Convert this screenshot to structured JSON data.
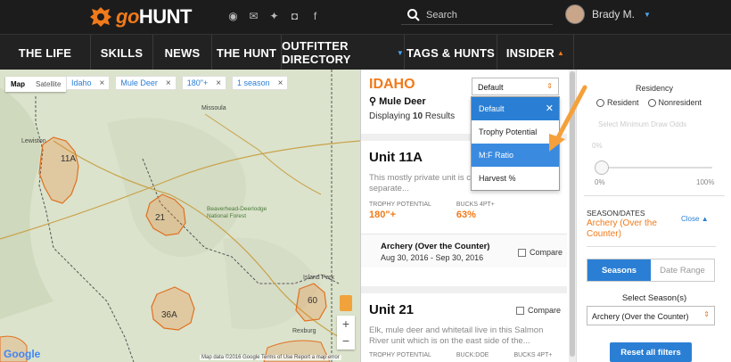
{
  "brand": {
    "logo_prefix": "go",
    "logo_name": "HUNT"
  },
  "header": {
    "search_placeholder": "Search",
    "user_name": "Brady M."
  },
  "nav": {
    "items": [
      "THE LIFE",
      "SKILLS",
      "NEWS",
      "THE HUNT",
      "OUTFITTER DIRECTORY",
      "TAGS & HUNTS",
      "INSIDER"
    ]
  },
  "map": {
    "type_map": "Map",
    "type_satellite": "Satellite",
    "chips": [
      "Idaho",
      "Mule Deer",
      "180\"+",
      "1 season"
    ],
    "units": [
      "11A",
      "21",
      "36A",
      "60"
    ],
    "cities": [
      "Missoula",
      "Lewiston",
      "Beaverhead-Deerlodge National Forest",
      "Island Park",
      "Rexburg"
    ],
    "footer": "Map data ©2016 Google   Terms of Use   Report a map error",
    "google": "Google"
  },
  "results": {
    "state": "IDAHO",
    "species": "Mule Deer",
    "displaying_prefix": "Displaying ",
    "count": "10",
    "displaying_suffix": " Results",
    "sort_selected": "Default",
    "sort_options": [
      "Default",
      "Trophy Potential",
      "M:F Ratio",
      "Harvest %"
    ],
    "cards": [
      {
        "unit": "Unit 11A",
        "desc": "This mostly private unit is c... fields and pastures separate...",
        "stat1_label": "TROPHY POTENTIAL",
        "stat1_value": "180\"+",
        "stat2_label": "BUCKS 4PT+",
        "stat2_value": "63%",
        "season_title": "Archery (Over the Counter)",
        "season_dates": "Aug 30, 2016 - Sep 30, 2016",
        "compare": "Compare"
      },
      {
        "unit": "Unit 21",
        "desc": "Elk, mule deer and whitetail live in this Salmon River unit which is on the east side of the...",
        "stat1_label": "TROPHY POTENTIAL",
        "stat2_label": "BUCK:DOE",
        "stat3_label": "BUCKS 4PT+",
        "compare": "Compare"
      }
    ]
  },
  "filters": {
    "residency_label": "Residency",
    "resident": "Resident",
    "nonresident": "Nonresident",
    "min_draw": "Select Minimum Draw Odds",
    "pct": "0%",
    "slider_min": "0%",
    "slider_max": "100%",
    "season_dates_label": "SEASON/DATES",
    "season_dates_value": "Archery (Over the Counter)",
    "close_label": "Close",
    "toggle_seasons": "Seasons",
    "toggle_date_range": "Date Range",
    "select_seasons_label": "Select Season(s)",
    "select_seasons_value": "Archery (Over the Counter)",
    "reset_label": "Reset all filters"
  },
  "colors": {
    "accent": "#f07a1a",
    "blue": "#2a7fd4",
    "nav_bg": "#222222"
  }
}
